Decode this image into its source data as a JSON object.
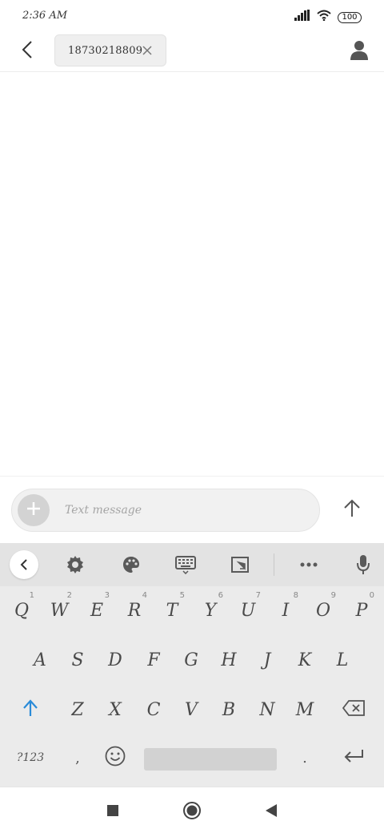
{
  "status_bar": {
    "time": "2:36 AM",
    "battery": "100",
    "icons": [
      "signal-icon",
      "wifi-icon",
      "battery-icon"
    ]
  },
  "header": {
    "recipient": "18730218809",
    "icons": [
      "back-arrow-icon",
      "close-icon",
      "person-icon"
    ]
  },
  "compose": {
    "placeholder": "Text message",
    "icons": [
      "plus-icon",
      "send-arrow-icon"
    ]
  },
  "keyboard": {
    "toolbar_icons": [
      "chevron-left-icon",
      "gear-icon",
      "palette-icon",
      "keyboard-icon",
      "resize-icon",
      "more-icon",
      "microphone-icon"
    ],
    "row1": [
      {
        "key": "Q",
        "hint": "1"
      },
      {
        "key": "W",
        "hint": "2"
      },
      {
        "key": "E",
        "hint": "3"
      },
      {
        "key": "R",
        "hint": "4"
      },
      {
        "key": "T",
        "hint": "5"
      },
      {
        "key": "Y",
        "hint": "6"
      },
      {
        "key": "U",
        "hint": "7"
      },
      {
        "key": "I",
        "hint": "8"
      },
      {
        "key": "O",
        "hint": "9"
      },
      {
        "key": "P",
        "hint": "0"
      }
    ],
    "row2": [
      "A",
      "S",
      "D",
      "F",
      "G",
      "H",
      "J",
      "K",
      "L"
    ],
    "row3": [
      "Z",
      "X",
      "C",
      "V",
      "B",
      "N",
      "M"
    ],
    "bottom_row": {
      "symbols_label": "?123",
      "comma": ",",
      "period": "."
    }
  },
  "nav_bar": {
    "icons": [
      "recents-square-icon",
      "home-circle-icon",
      "back-triangle-icon"
    ]
  },
  "colors": {
    "shift_accent": "#2a8bd8",
    "keyboard_bg": "#ebebeb",
    "toolbar_bg": "#e3e3e3"
  }
}
